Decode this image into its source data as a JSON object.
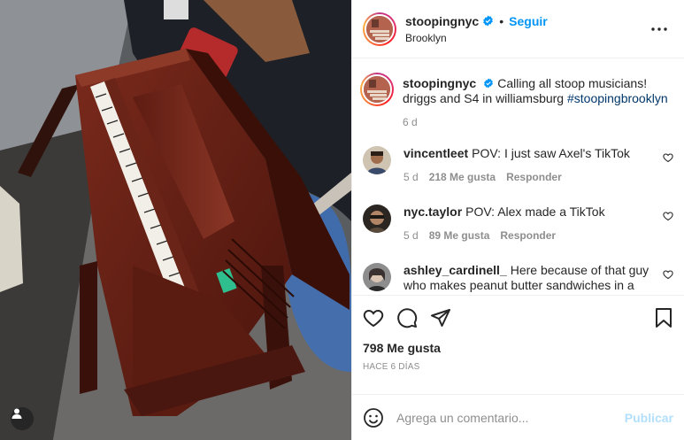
{
  "post": {
    "username": "stoopingnyc",
    "follow_label": "Seguir",
    "dot": "•",
    "location": "Brooklyn",
    "more_icon": "ellipsis-icon",
    "verified_color": "#0095f6"
  },
  "caption": {
    "username": "stoopingnyc",
    "text": "Calling all stoop musicians! driggs and S4 in williamsburg",
    "hashtag": "#stoopingbrooklyn",
    "age": "6 d"
  },
  "comments": [
    {
      "username": "vincentleet",
      "text": "POV: I just saw Axel's TikTok",
      "age": "5 d",
      "likes": "218 Me gusta",
      "reply": "Responder"
    },
    {
      "username": "nyc.taylor",
      "text": "POV: Alex made a TikTok",
      "age": "5 d",
      "likes": "89 Me gusta",
      "reply": "Responder"
    },
    {
      "username": "ashley_cardinell_",
      "text": "Here because of that guy who makes peanut butter sandwiches in a"
    }
  ],
  "actions": {
    "likes": "798 Me gusta",
    "timestamp": "HACE 6 DÍAS"
  },
  "add_comment": {
    "placeholder": "Agrega un comentario...",
    "post_label": "Publicar"
  },
  "colors": {
    "accent": "#0095f6",
    "hashtag": "#00376b",
    "muted": "#8e8e8e",
    "post_disabled": "#b2dffc"
  }
}
